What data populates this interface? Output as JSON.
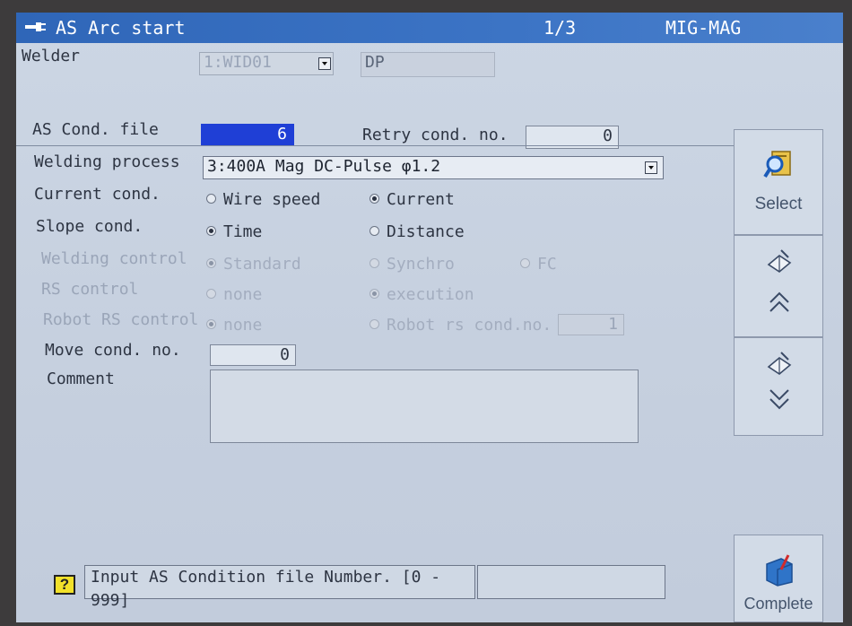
{
  "titlebar": {
    "title": "AS Arc start",
    "page": "1/3",
    "mode": "MIG-MAG"
  },
  "welder": {
    "label": "Welder",
    "value": "1:WID01",
    "name": "DP"
  },
  "as_cond": {
    "label": "AS Cond. file",
    "value": "6"
  },
  "retry": {
    "label": "Retry cond. no.",
    "value": "0"
  },
  "process": {
    "label": "Welding process",
    "value": "3:400A Mag DC-Pulse φ1.2"
  },
  "current_cond": {
    "label": "Current cond.",
    "opt1": "Wire speed",
    "opt2": "Current",
    "selected": "Current"
  },
  "slope_cond": {
    "label": "Slope cond.",
    "opt1": "Time",
    "opt2": "Distance",
    "selected": "Time"
  },
  "welding_control": {
    "label": "Welding control",
    "opt1": "Standard",
    "opt2": "Synchro",
    "opt3": "FC",
    "selected": "Standard"
  },
  "rs_control": {
    "label": "RS control",
    "opt1": "none",
    "opt2": "execution",
    "selected": "execution"
  },
  "robot_rs": {
    "label": "Robot RS control",
    "opt1": "none",
    "opt2": "Robot rs cond.no.",
    "selected": "none",
    "value": "1"
  },
  "move_cond": {
    "label": "Move cond. no.",
    "value": "0"
  },
  "comment": {
    "label": "Comment",
    "value": ""
  },
  "sidebar": {
    "select_label": "Select"
  },
  "status": {
    "message": "Input AS Condition file Number.  [0 - 999]"
  },
  "complete": {
    "label": "Complete"
  },
  "colors": {
    "titlebar": "#3566b8",
    "selected_field": "#1f3fd6",
    "background": "#c8d3e2"
  }
}
